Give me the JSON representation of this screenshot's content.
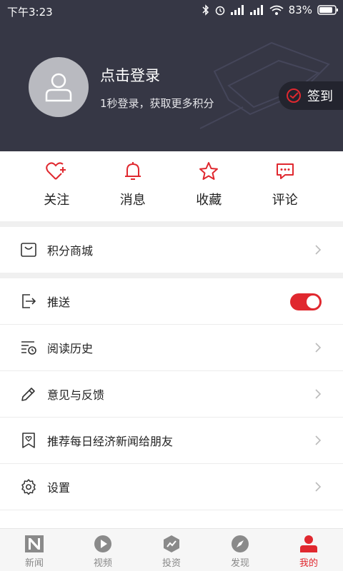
{
  "status_bar": {
    "time": "下午3:23",
    "battery": "83%"
  },
  "profile": {
    "login_title": "点击登录",
    "login_subtitle": "1秒登录，获取更多积分",
    "checkin_label": "签到"
  },
  "quick_actions": [
    {
      "label": "关注",
      "icon": "heart-plus-icon"
    },
    {
      "label": "消息",
      "icon": "bell-icon"
    },
    {
      "label": "收藏",
      "icon": "star-icon"
    },
    {
      "label": "评论",
      "icon": "comment-icon"
    }
  ],
  "menu": {
    "points_mall": "积分商城",
    "push": "推送",
    "push_enabled": true,
    "history": "阅读历史",
    "feedback": "意见与反馈",
    "recommend": "推荐每日经济新闻给朋友",
    "settings": "设置"
  },
  "bottom_nav": [
    {
      "label": "新闻",
      "icon": "news-icon",
      "active": false
    },
    {
      "label": "视频",
      "icon": "video-icon",
      "active": false
    },
    {
      "label": "投资",
      "icon": "invest-icon",
      "active": false
    },
    {
      "label": "发现",
      "icon": "compass-icon",
      "active": false
    },
    {
      "label": "我的",
      "icon": "user-icon",
      "active": true
    }
  ],
  "colors": {
    "accent": "#e0282f",
    "header_bg": "#363745"
  }
}
